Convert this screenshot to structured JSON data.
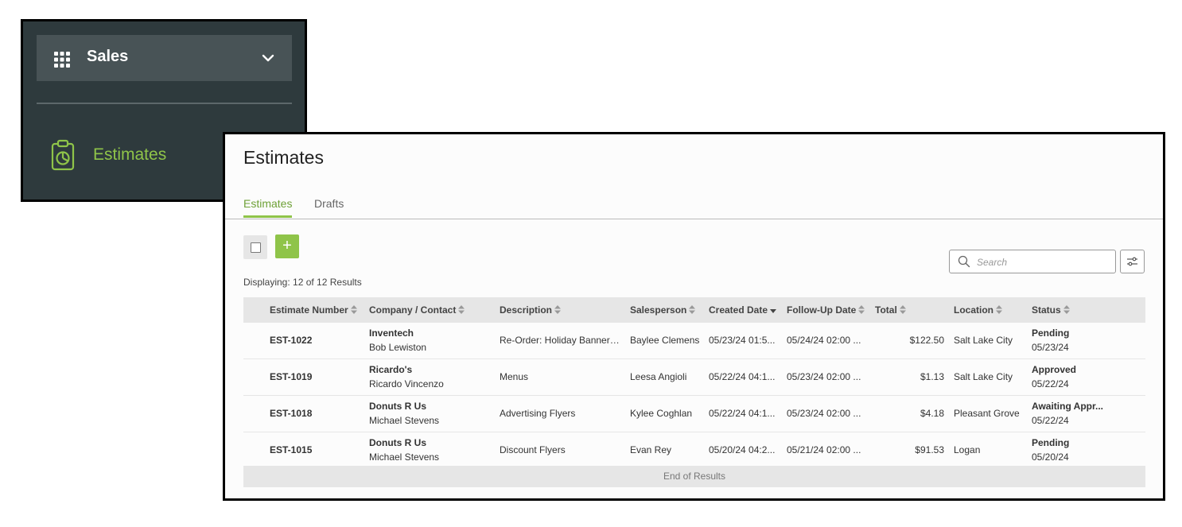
{
  "nav": {
    "module_label": "Sales",
    "item_label": "Estimates",
    "accent_color": "#8fc449"
  },
  "page": {
    "title": "Estimates",
    "tabs": [
      {
        "label": "Estimates",
        "active": true
      },
      {
        "label": "Drafts",
        "active": false
      }
    ],
    "add_label": "+",
    "result_count": "Displaying: 12 of 12 Results",
    "search_placeholder": "Search",
    "end_of_results": "End of Results"
  },
  "table": {
    "headers": [
      "Estimate Number",
      "Company / Contact",
      "Description",
      "Salesperson",
      "Created Date",
      "Follow-Up Date",
      "Total",
      "Location",
      "Status"
    ],
    "sorted_column": "Created Date",
    "rows": [
      {
        "number": "EST-1022",
        "company": "Inventech",
        "contact": "Bob Lewiston",
        "description": "Re-Order: Holiday Banners ...",
        "salesperson": "Baylee Clemens",
        "created": "05/23/24 01:5...",
        "followup": "05/24/24 02:00 ...",
        "total": "$122.50",
        "location": "Salt Lake City",
        "status": "Pending",
        "status_date": "05/23/24"
      },
      {
        "number": "EST-1019",
        "company": "Ricardo's",
        "contact": "Ricardo Vincenzo",
        "description": "Menus",
        "salesperson": "Leesa Angioli",
        "created": "05/22/24 04:1...",
        "followup": "05/23/24 02:00 ...",
        "total": "$1.13",
        "location": "Salt Lake City",
        "status": "Approved",
        "status_date": "05/22/24"
      },
      {
        "number": "EST-1018",
        "company": "Donuts R Us",
        "contact": "Michael Stevens",
        "description": "Advertising Flyers",
        "salesperson": "Kylee Coghlan",
        "created": "05/22/24 04:1...",
        "followup": "05/23/24 02:00 ...",
        "total": "$4.18",
        "location": "Pleasant Grove",
        "status": "Awaiting Appr...",
        "status_date": "05/22/24"
      },
      {
        "number": "EST-1015",
        "company": "Donuts R Us",
        "contact": "Michael Stevens",
        "description": "Discount Flyers",
        "salesperson": "Evan Rey",
        "created": "05/20/24 04:2...",
        "followup": "05/21/24 02:00 ...",
        "total": "$91.53",
        "location": "Logan",
        "status": "Pending",
        "status_date": "05/20/24"
      }
    ]
  }
}
